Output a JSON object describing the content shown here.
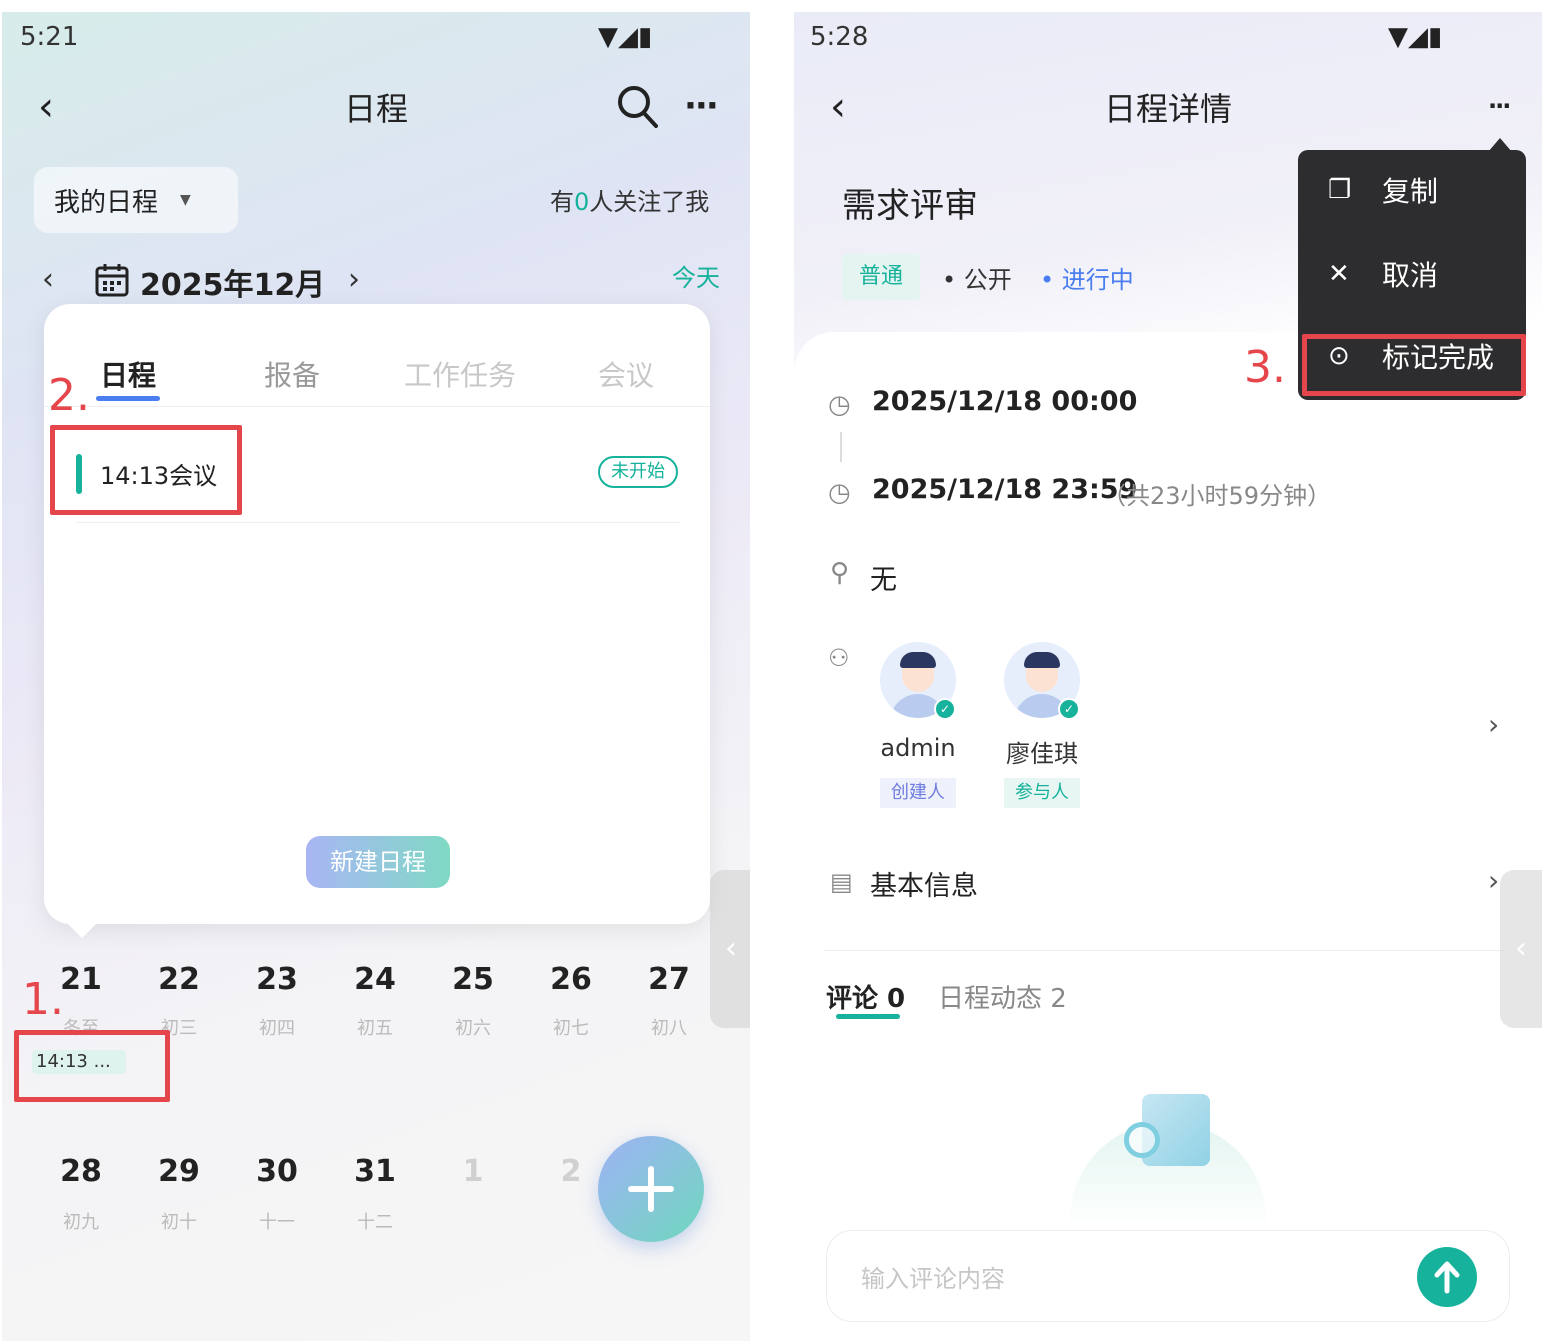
{
  "left": {
    "status_time": "5:21",
    "title": "日程",
    "filter_label": "我的日程",
    "follow_prefix": "有",
    "follow_count": "0",
    "follow_suffix": "人关注了我",
    "month_label": "2025年12月",
    "today_label": "今天",
    "tabs": [
      {
        "label": "日程"
      },
      {
        "label": "报备"
      },
      {
        "label": "工作任务"
      },
      {
        "label": "会议"
      }
    ],
    "event": {
      "title": "14:13会议",
      "status": "未开始"
    },
    "new_button": "新建日程",
    "week1": [
      {
        "day": "21",
        "lunar": "冬至"
      },
      {
        "day": "22",
        "lunar": "初三"
      },
      {
        "day": "23",
        "lunar": "初四"
      },
      {
        "day": "24",
        "lunar": "初五"
      },
      {
        "day": "25",
        "lunar": "初六"
      },
      {
        "day": "26",
        "lunar": "初七"
      },
      {
        "day": "27",
        "lunar": "初八"
      }
    ],
    "week1_event_chip": "14:13 ...",
    "week2": [
      {
        "day": "28",
        "lunar": "初九"
      },
      {
        "day": "29",
        "lunar": "初十"
      },
      {
        "day": "30",
        "lunar": "十一"
      },
      {
        "day": "31",
        "lunar": "十二"
      },
      {
        "day": "1",
        "lunar": ""
      },
      {
        "day": "2",
        "lunar": ""
      }
    ],
    "annotations": [
      "1.",
      "2."
    ]
  },
  "right": {
    "status_time": "5:28",
    "title": "日程详情",
    "event_title": "需求评审",
    "tag_level": "普通",
    "tag_visibility": "公开",
    "tag_status": "进行中",
    "start_time": "2025/12/18 00:00",
    "end_time": "2025/12/18 23:59",
    "duration": "（共23小时59分钟）",
    "location": "无",
    "participants": [
      {
        "name": "admin",
        "role": "创建人"
      },
      {
        "name": "廖佳琪",
        "role": "参与人"
      }
    ],
    "basic_info": "基本信息",
    "comment_tab": "评论 0",
    "activity_tab": "日程动态 2",
    "comment_placeholder": "输入评论内容",
    "menu": [
      {
        "icon": "copy-icon",
        "label": "复制"
      },
      {
        "icon": "close-icon",
        "label": "取消"
      },
      {
        "icon": "check-circle-icon",
        "label": "标记完成"
      }
    ],
    "annotation": "3."
  },
  "colors": {
    "accent_teal": "#16b29b",
    "accent_blue": "#4a7df0",
    "annotation_red": "#e5464b",
    "menu_bg": "#2d2d2f"
  }
}
